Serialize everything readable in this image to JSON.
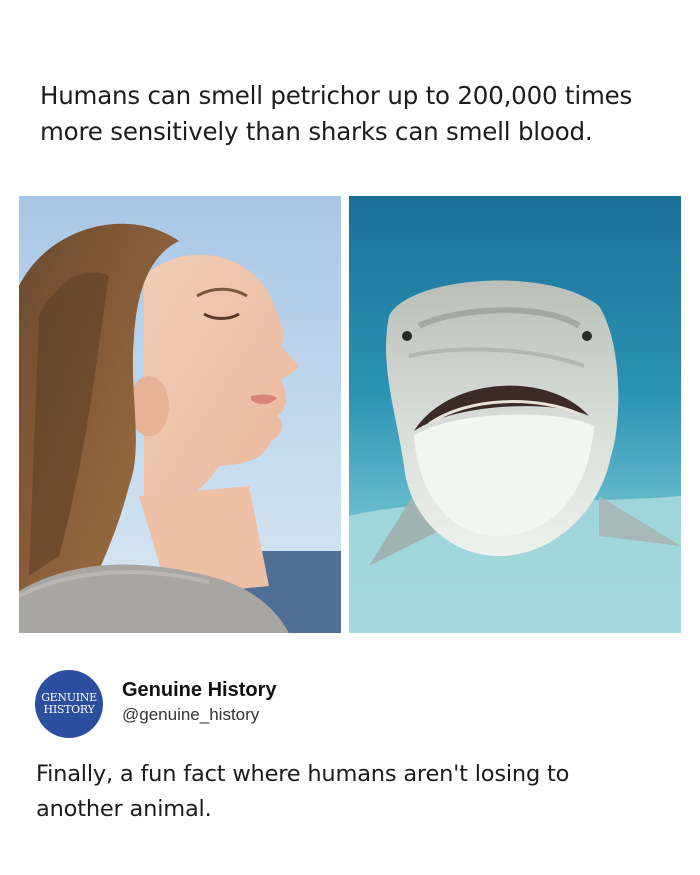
{
  "headline": {
    "line1": "Humans can smell petrichor up to 200,000 times",
    "line2": "more sensitively than sharks can smell blood."
  },
  "images": {
    "left": {
      "name": "woman-smelling-air-photo"
    },
    "right": {
      "name": "tiger-shark-photo"
    }
  },
  "author": {
    "avatar_line1": "GENUINE",
    "avatar_line2": "HISTORY",
    "name": "Genuine History",
    "handle": "@genuine_history",
    "avatar_color": "#2b4f9e"
  },
  "caption": {
    "line1": "Finally, a fun fact where humans aren't losing to",
    "line2": "another animal."
  }
}
